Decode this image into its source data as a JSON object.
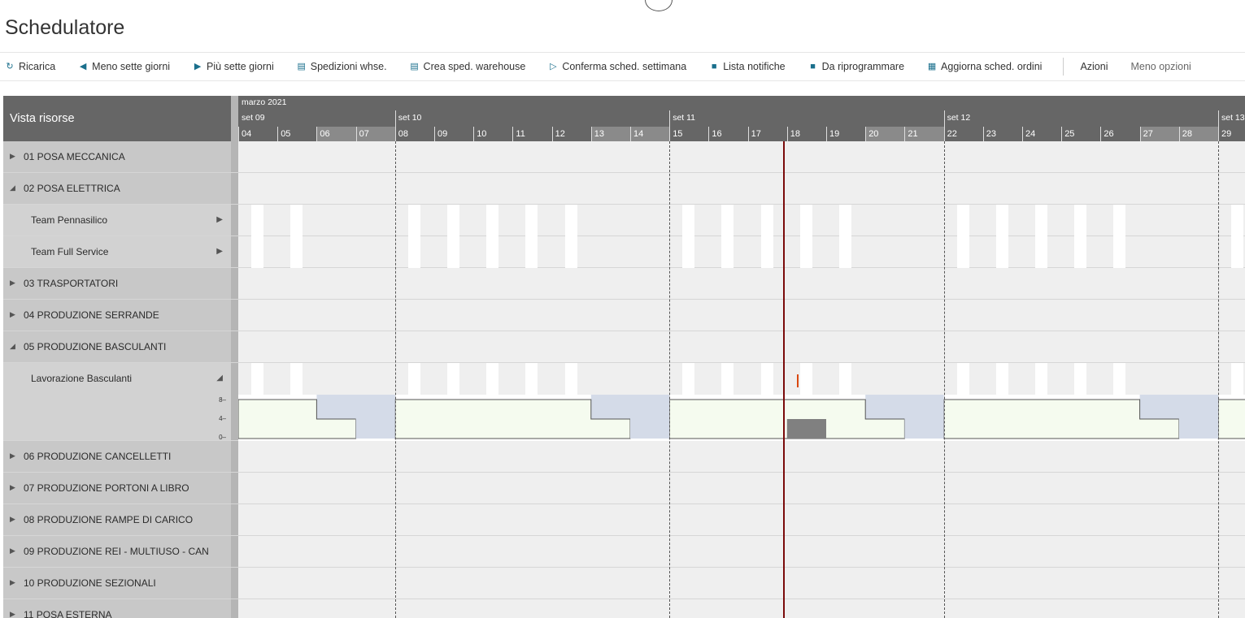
{
  "page": {
    "title": "Schedulatore"
  },
  "toolbar": {
    "items": [
      {
        "label": "Ricarica",
        "icon": "refresh-icon"
      },
      {
        "label": "Meno sette giorni",
        "icon": "rewind-icon"
      },
      {
        "label": "Più sette giorni",
        "icon": "fast-forward-icon"
      },
      {
        "label": "Spedizioni whse.",
        "icon": "shipment-icon"
      },
      {
        "label": "Crea sped. warehouse",
        "icon": "create-shipment-icon"
      },
      {
        "label": "Conferma sched. settimana",
        "icon": "confirm-document-icon"
      },
      {
        "label": "Lista notifiche",
        "icon": "list-icon"
      },
      {
        "label": "Da riprogrammare",
        "icon": "reschedule-icon"
      },
      {
        "label": "Aggiorna sched. ordini",
        "icon": "update-schedule-icon"
      }
    ],
    "actions_label": "Azioni",
    "less_options_label": "Meno opzioni"
  },
  "gantt": {
    "left_header": "Vista risorse",
    "month": "marzo 2021",
    "weeks": [
      "set 09",
      "set 10",
      "set 11",
      "set 12",
      "set 13"
    ],
    "days": [
      "04",
      "05",
      "06",
      "07",
      "08",
      "09",
      "10",
      "11",
      "12",
      "13",
      "14",
      "15",
      "16",
      "17",
      "18",
      "19",
      "20",
      "21",
      "22",
      "23",
      "24",
      "25",
      "26",
      "27",
      "28",
      "29"
    ],
    "weekend_days": [
      "06",
      "07",
      "13",
      "14",
      "20",
      "21",
      "27",
      "28"
    ],
    "rows": [
      {
        "label": "01 POSA MECCANICA",
        "expanded": false
      },
      {
        "label": "02 POSA ELETTRICA",
        "expanded": true
      },
      {
        "label": "Team Pennasilico",
        "sub": true
      },
      {
        "label": "Team Full Service",
        "sub": true
      },
      {
        "label": "03 TRASPORTATORI",
        "expanded": false
      },
      {
        "label": "04 PRODUZIONE SERRANDE",
        "expanded": false
      },
      {
        "label": "05 PRODUZIONE BASCULANTI",
        "expanded": true
      },
      {
        "label": "Lavorazione Basculanti",
        "sub": true
      },
      {
        "label": "06 PRODUZIONE CANCELLETTI",
        "expanded": false
      },
      {
        "label": "07 PRODUZIONE PORTONI A LIBRO",
        "expanded": false
      },
      {
        "label": "08 PRODUZIONE RAMPE DI CARICO",
        "expanded": false
      },
      {
        "label": "09 PRODUZIONE REI - MULTIUSO - CAN",
        "expanded": false
      },
      {
        "label": "10 PRODUZIONE SEZIONALI",
        "expanded": false
      },
      {
        "label": "11 POSA ESTERNA",
        "expanded": false
      }
    ],
    "capacity_axis": [
      "8",
      "4",
      "0"
    ]
  },
  "colors": {
    "today_line": "#7a0a0a",
    "header_bg": "#666666",
    "capacity_fill": "#f5fbef",
    "capacity_weekend": "#d4dbe8",
    "booked": "#808080"
  }
}
